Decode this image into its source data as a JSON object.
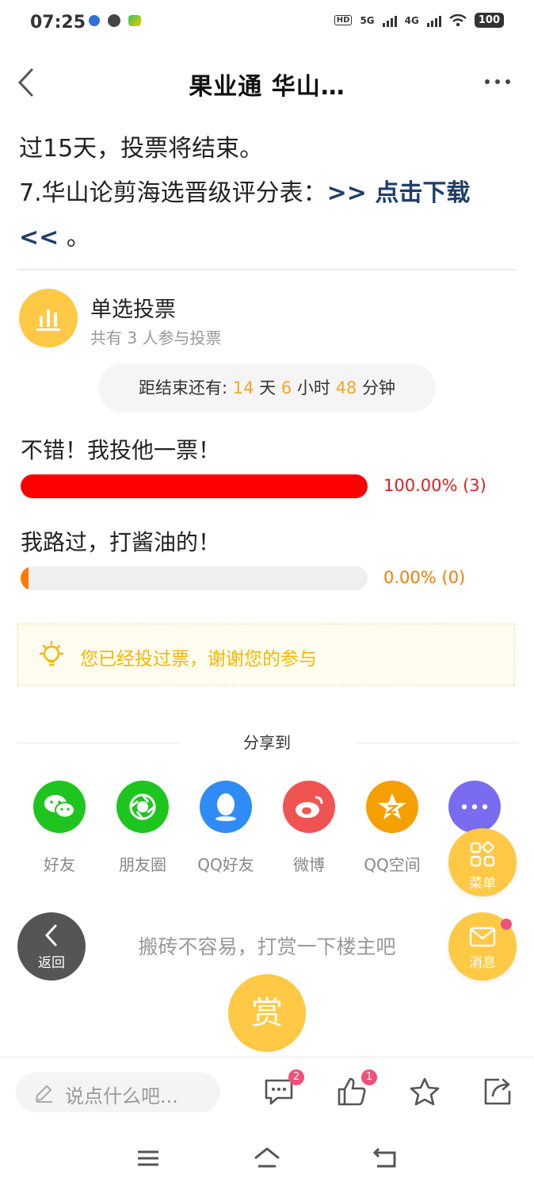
{
  "status_bar": {
    "time": "07:25",
    "battery": "100",
    "net1": "5G",
    "net2": "4G",
    "hd": "HD"
  },
  "header": {
    "title": "果业通 华山…"
  },
  "article": {
    "line1": "过15天，投票将结束。",
    "line2_prefix": "7.华山论剪海选晋级评分表：",
    "download_link": ">> 点击下载",
    "line3_link": "<<",
    "line3_suffix": " 。"
  },
  "poll": {
    "title": "单选投票",
    "participants": "共有 3 人参与投票",
    "countdown": {
      "prefix": "距结束还有:",
      "days": "14",
      "days_unit": "天",
      "hours": "6",
      "hours_unit": "小时",
      "minutes": "48",
      "minutes_unit": "分钟"
    },
    "options": [
      {
        "label": "不错！我投他一票！",
        "result": "100.00% (3)",
        "fraction": 1.0,
        "color": "#ff0000"
      },
      {
        "label": "我路过，打酱油的！",
        "result": "0.00% (0)",
        "fraction": 0.0,
        "color": "#ff7a00"
      }
    ],
    "notice": "您已经投过票，谢谢您的参与"
  },
  "share": {
    "title": "分享到",
    "items": [
      {
        "label": "好友",
        "icon": "wechat-icon",
        "color": "#1ec51e"
      },
      {
        "label": "朋友圈",
        "icon": "moments-icon",
        "color": "#1ec51e"
      },
      {
        "label": "QQ好友",
        "icon": "qq-icon",
        "color": "#2f8cf5"
      },
      {
        "label": "微博",
        "icon": "weibo-icon",
        "color": "#f05452"
      },
      {
        "label": "QQ空间",
        "icon": "qzone-icon",
        "color": "#f5a000"
      },
      {
        "label": "",
        "icon": "more-icon",
        "color": "#7a6cf0"
      }
    ]
  },
  "floating": {
    "menu": "菜单",
    "messages": "消息",
    "back": "返回"
  },
  "reward": {
    "tip": "搬砖不容易，打赏一下楼主吧",
    "button": "赏"
  },
  "toolbar": {
    "comment_placeholder": "说点什么吧...",
    "comments_badge": "2",
    "likes_badge": "1"
  },
  "colors": {
    "accent": "#ffc845",
    "link": "#1f3f6b",
    "badge": "#f0507a"
  }
}
